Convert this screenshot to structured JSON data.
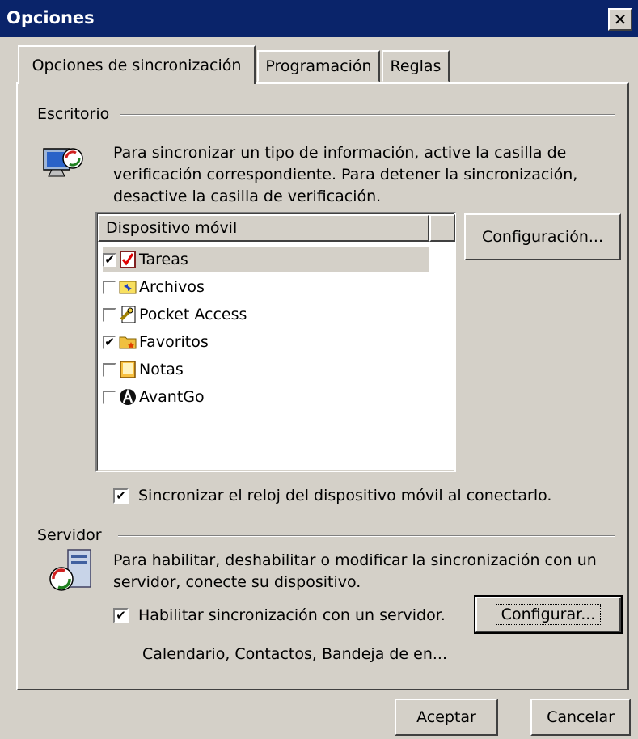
{
  "window": {
    "title": "Opciones",
    "close_glyph": "✕"
  },
  "tabs": [
    "Opciones de sincronización",
    "Programación",
    "Reglas"
  ],
  "desktop": {
    "group_label": "Escritorio",
    "description": [
      "Para sincronizar un tipo de información, active la casilla de",
      "verificación correspondiente. Para detener la sincronización,",
      "desactive la casilla de verificación."
    ],
    "list_header": "Dispositivo móvil",
    "items": [
      {
        "label": "Tareas",
        "checked": true,
        "icon": "tasks-icon"
      },
      {
        "label": "Archivos",
        "checked": false,
        "icon": "files-icon"
      },
      {
        "label": "Pocket Access",
        "checked": false,
        "icon": "pocket-access-icon"
      },
      {
        "label": "Favoritos",
        "checked": true,
        "icon": "favorites-icon"
      },
      {
        "label": "Notas",
        "checked": false,
        "icon": "notes-icon"
      },
      {
        "label": "AvantGo",
        "checked": false,
        "icon": "avantgo-icon"
      }
    ],
    "config_button": "Configuración...",
    "clock_sync": {
      "label": "Sincronizar el reloj del dispositivo móvil al conectarlo.",
      "checked": true
    }
  },
  "server": {
    "group_label": "Servidor",
    "description": [
      "Para habilitar, deshabilitar o modificar la sincronización con un",
      "servidor, conecte su dispositivo."
    ],
    "enable": {
      "label": "Habilitar sincronización con un servidor.",
      "checked": true
    },
    "configure_button": "Configurar...",
    "summary": "Calendario, Contactos, Bandeja de en..."
  },
  "footer": {
    "ok": "Aceptar",
    "cancel": "Cancelar"
  }
}
